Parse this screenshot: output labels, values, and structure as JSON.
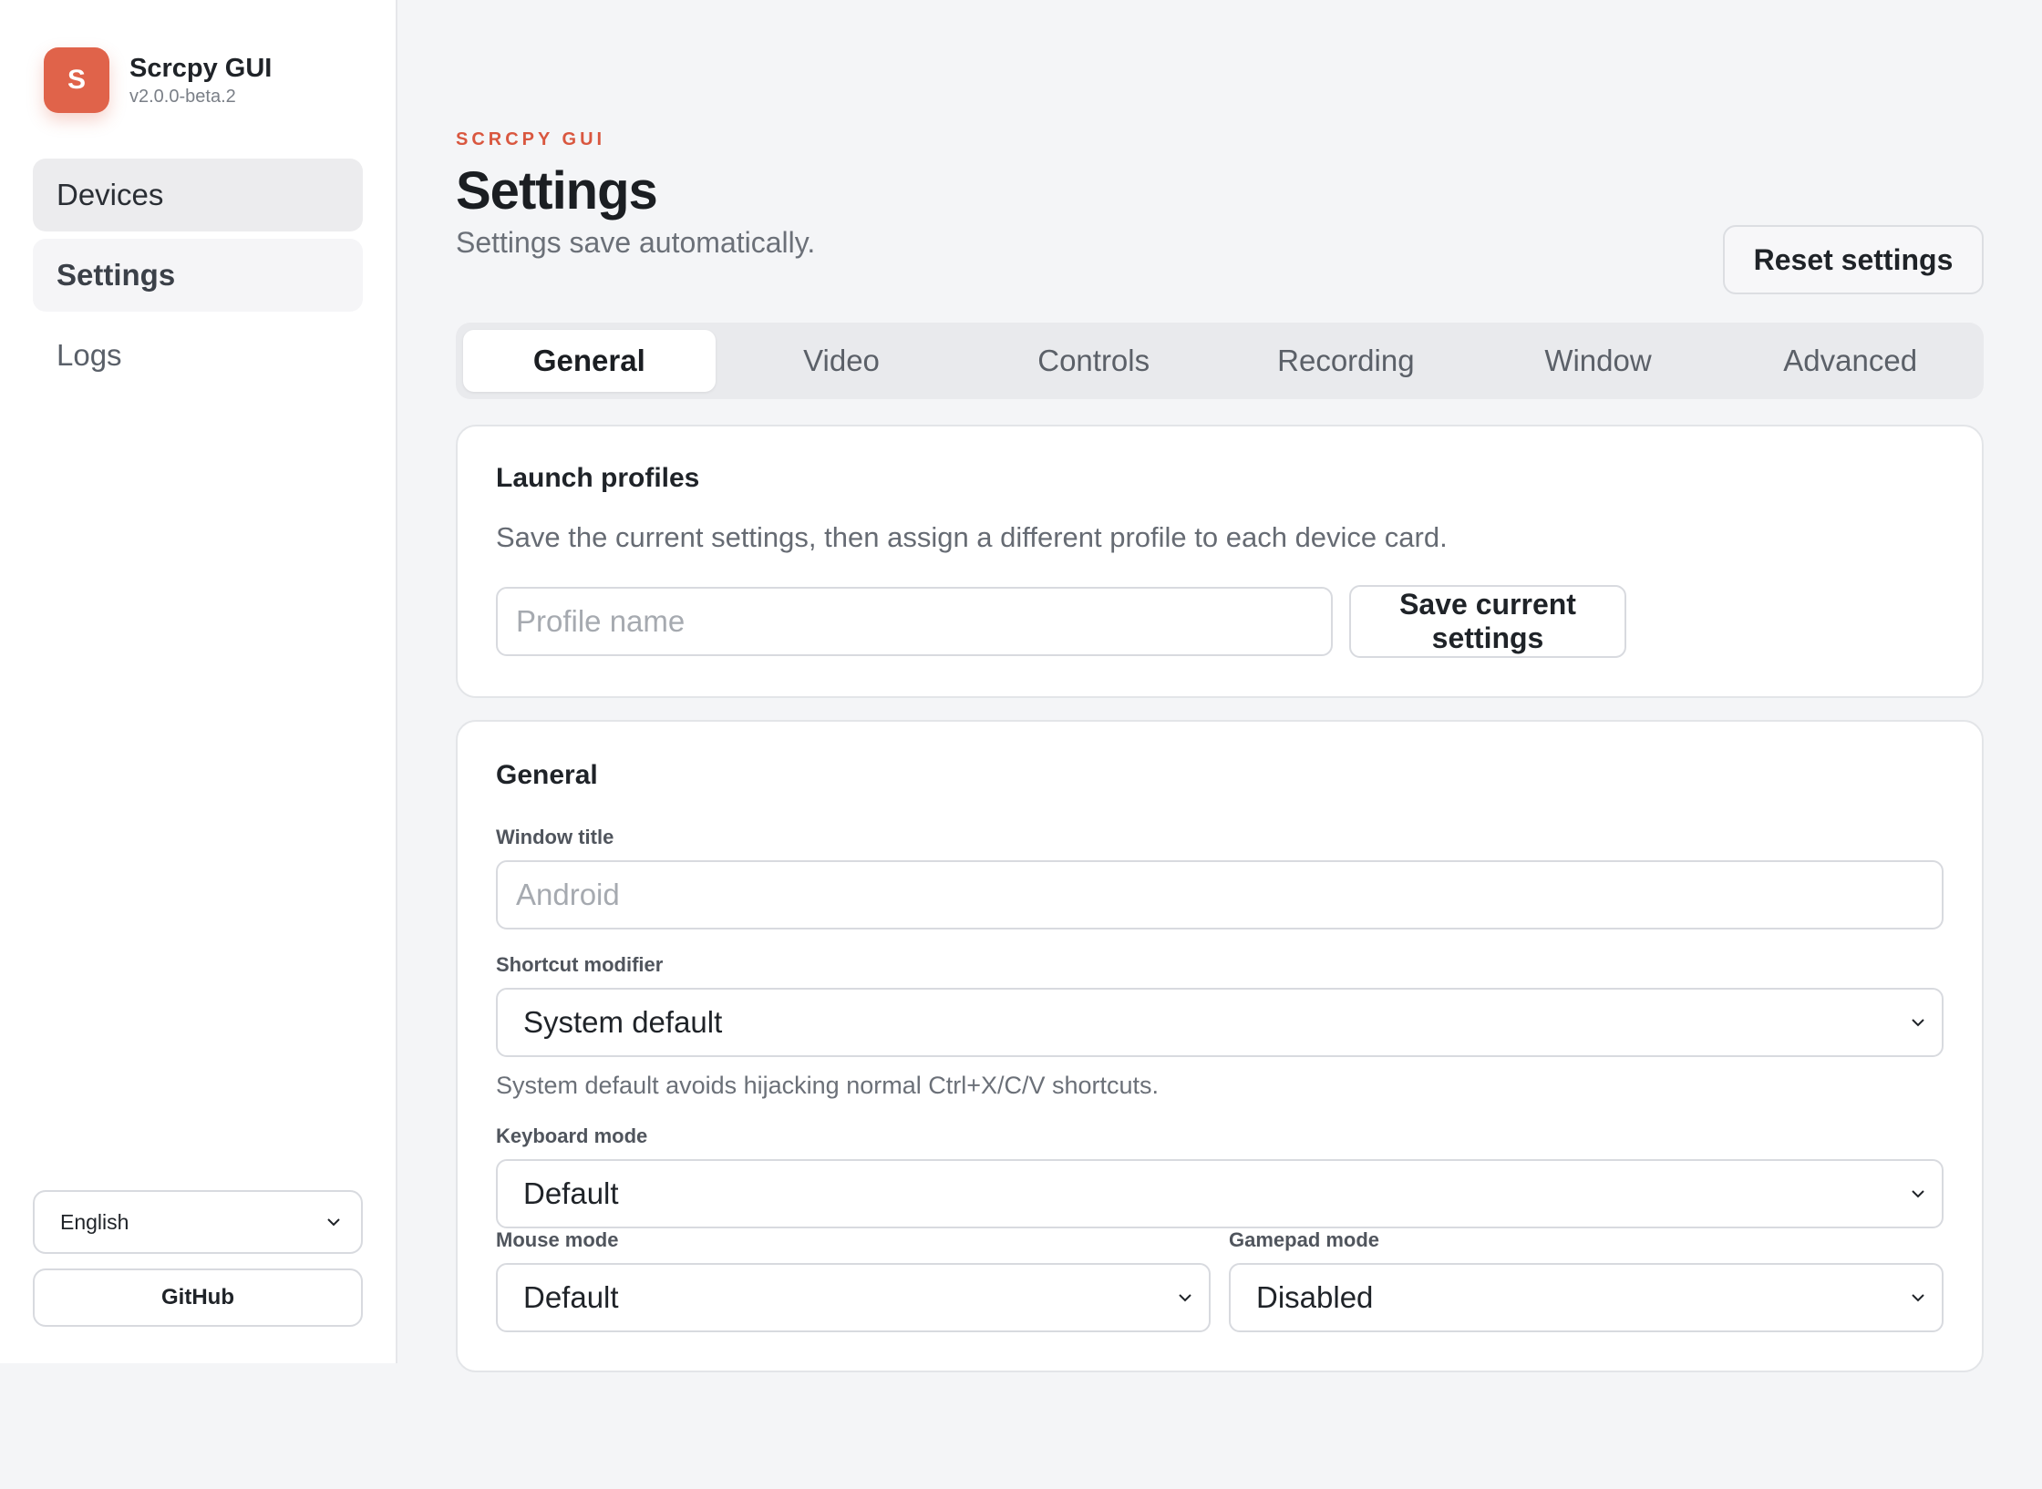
{
  "app": {
    "logo_letter": "S",
    "name": "Scrcpy GUI",
    "version": "v2.0.0-beta.2",
    "accent_color": "#e0634a"
  },
  "sidebar": {
    "items": [
      {
        "label": "Devices"
      },
      {
        "label": "Settings"
      },
      {
        "label": "Logs"
      }
    ],
    "language": {
      "selected": "English"
    },
    "github_label": "GitHub"
  },
  "header": {
    "eyebrow": "SCRCPY GUI",
    "title": "Settings",
    "subtitle": "Settings save automatically.",
    "reset_label": "Reset settings"
  },
  "tabs": [
    {
      "label": "General",
      "active": true
    },
    {
      "label": "Video"
    },
    {
      "label": "Controls"
    },
    {
      "label": "Recording"
    },
    {
      "label": "Window"
    },
    {
      "label": "Advanced"
    }
  ],
  "profiles_card": {
    "title": "Launch profiles",
    "description": "Save the current settings, then assign a different profile to each device card.",
    "profile_name_placeholder": "Profile name",
    "save_label": "Save current settings"
  },
  "general_card": {
    "title": "General",
    "window_title": {
      "label": "Window title",
      "placeholder": "Android"
    },
    "shortcut_modifier": {
      "label": "Shortcut modifier",
      "selected": "System default",
      "hint": "System default avoids hijacking normal Ctrl+X/C/V shortcuts."
    },
    "keyboard_mode": {
      "label": "Keyboard mode",
      "selected": "Default"
    },
    "mouse_mode": {
      "label": "Mouse mode",
      "selected": "Default"
    },
    "gamepad_mode": {
      "label": "Gamepad mode",
      "selected": "Disabled"
    }
  }
}
